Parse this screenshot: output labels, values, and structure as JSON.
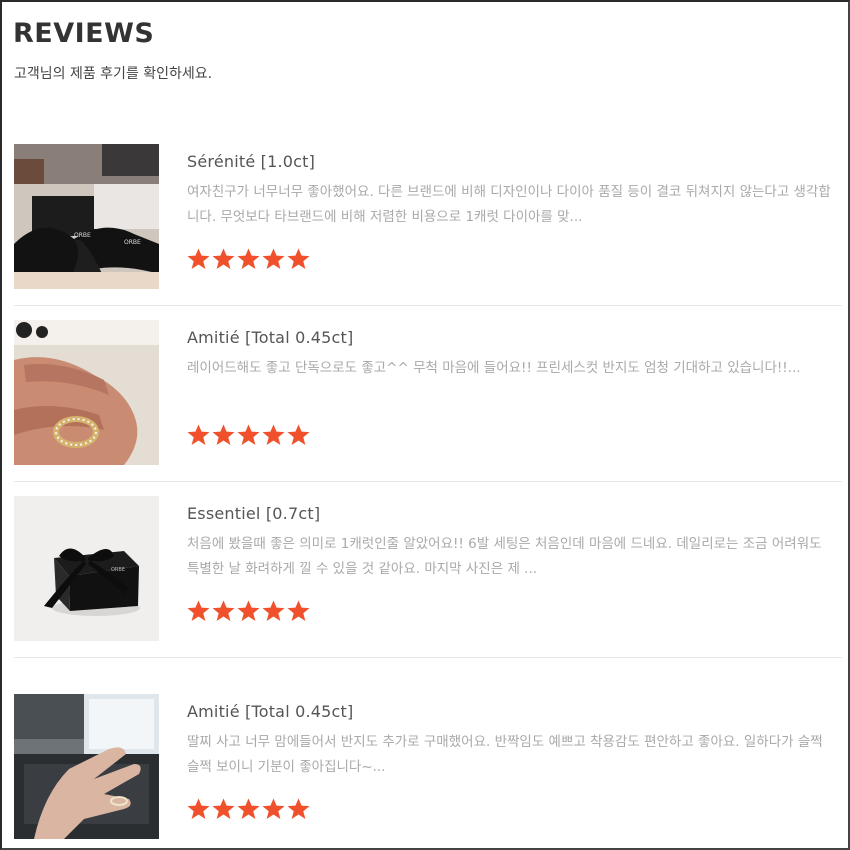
{
  "header": {
    "title": "REVIEWS",
    "subtitle": "고객님의 제품 후기를 확인하세요."
  },
  "colors": {
    "star": "#f0502c",
    "review_text": "#a9a9a9"
  },
  "reviews": [
    {
      "product": "Sérénité [1.0ct]",
      "text": "여자친구가 너무너무 좋아했어요. 다른 브랜드에 비해 디자인이나 다이아 품질 등이 결코 뒤쳐지지 않는다고 생각합니다. 무엇보다 타브랜드에 비해 저렴한 비용으로 1캐럿 다이아를 맞...",
      "rating": 5,
      "image_icon": "ring-box-with-ribbon-photo"
    },
    {
      "product": "Amitié [Total 0.45ct]",
      "text": "레이어드해도 좋고 단독으로도 좋고^^ 무척 마음에 들어요!! 프린세스컷 반지도 엄청 기대하고 있습니다!!...",
      "rating": 5,
      "image_icon": "hand-with-gold-ring-photo"
    },
    {
      "product": "Essentiel [0.7ct]",
      "text": "처음에 봤을때 좋은 의미로 1캐럿인줄 알았어요!! 6발 세팅은 처음인데 마음에 드네요. 데일리로는 조금 어려워도 특별한 날 화려하게 낄 수 있을 것 같아요. 마지막 사진은 제 ...",
      "rating": 5,
      "image_icon": "black-gift-box-photo"
    },
    {
      "product": "Amitié [Total 0.45ct]",
      "text": "딸찌 사고 너무 맘에들어서 반지도 추가로 구매했어요. 반짝임도 예쁘고 착용감도 편안하고 좋아요. 일하다가 슬쩍슬쩍 보이니 기분이 좋아집니다~...",
      "rating": 5,
      "image_icon": "hand-on-laptop-photo"
    }
  ]
}
